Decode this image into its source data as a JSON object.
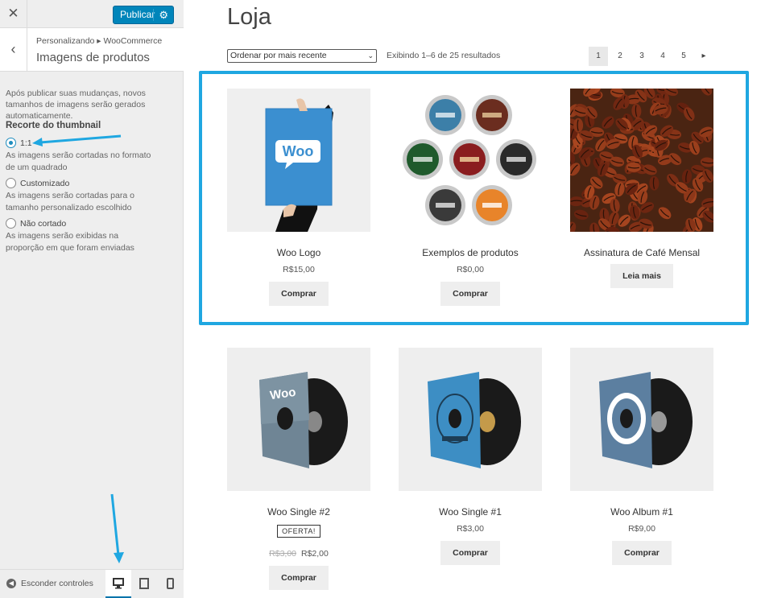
{
  "sidebar": {
    "close_glyph": "✕",
    "publish_label": "Publicar",
    "back_glyph": "‹",
    "breadcrumb": "Personalizando ▸ WooCommerce",
    "section_title": "Imagens de produtos",
    "notice": "Após publicar suas mudanças, novos tamanhos de imagens serão gerados automaticamente.",
    "crop_title": "Recorte do thumbnail",
    "options": [
      {
        "label": "1:1",
        "desc": "As imagens serão cortadas no formato de um quadrado",
        "checked": true
      },
      {
        "label": "Customizado",
        "desc": "As imagens serão cortadas para o tamanho personalizado escolhido",
        "checked": false
      },
      {
        "label": "Não cortado",
        "desc": "As imagens serão exibidas na proporção em que foram enviadas",
        "checked": false
      }
    ],
    "hide_controls_label": "Esconder controles",
    "active_device": "desktop"
  },
  "shop": {
    "title": "Loja",
    "sort_label": "Ordenar por mais recente",
    "result_count": "Exibindo 1–6 de 25 resultados",
    "pages": [
      "1",
      "2",
      "3",
      "4",
      "5",
      "▸"
    ],
    "current_page": "1"
  },
  "products": [
    {
      "name": "Woo Logo",
      "price": "R$15,00",
      "button": "Comprar",
      "image_text": "Woo"
    },
    {
      "name": "Exemplos de produtos",
      "price": "R$0,00",
      "button": "Comprar"
    },
    {
      "name": "Assinatura de Café Mensal",
      "price": "",
      "button": "Leia mais"
    },
    {
      "name": "Woo Single #2",
      "badge": "OFERTA!",
      "old_price": "R$3,00",
      "price": "R$2,00",
      "button": "Comprar",
      "image_text": "Woo"
    },
    {
      "name": "Woo Single #1",
      "price": "R$3,00",
      "button": "Comprar"
    },
    {
      "name": "Woo Album #1",
      "price": "R$9,00",
      "button": "Comprar"
    }
  ],
  "colors": {
    "accent": "#0085ba",
    "highlight": "#1fa7e1",
    "arrow": "#1fa7e1"
  },
  "icons": [
    "close-icon",
    "gear-icon",
    "back-chevron-icon",
    "hide-controls-icon",
    "desktop-icon",
    "tablet-icon",
    "mobile-icon",
    "next-page-icon",
    "dropdown-caret-icon"
  ]
}
